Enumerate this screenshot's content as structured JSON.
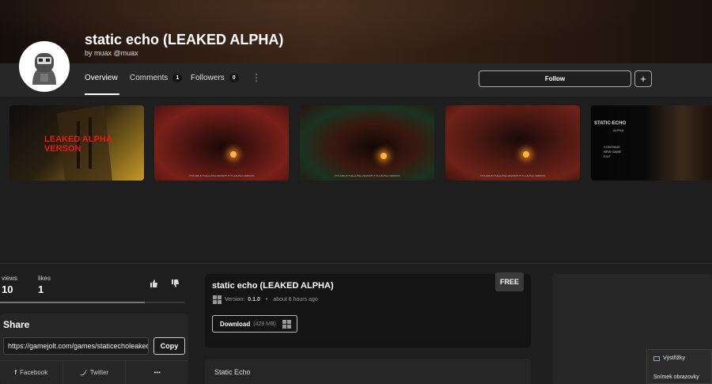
{
  "game": {
    "title": "static echo (LEAKED ALPHA)",
    "author": "by muax @muax"
  },
  "nav": {
    "overview": "Overview",
    "comments": "Comments",
    "comments_count": "1",
    "followers": "Followers",
    "followers_count": "0",
    "more": "⋮",
    "follow": "Follow",
    "plus": "+"
  },
  "thumbnails": {
    "first_overlay": "LEAKED ALPHA VERSON",
    "caption": "YOU ARE IN THE ALPHA VERSION IT IS A ALPHA VERSION",
    "menu_title": "STATIC-ECHO",
    "menu_subtitle": "ALPHA",
    "menu_items": [
      "CONTINUE",
      "NEW GAME",
      "EXIT"
    ]
  },
  "stats": {
    "views_label": "views",
    "views_value": "10",
    "likes_label": "likes",
    "likes_value": "1",
    "like_ratio": 0.78
  },
  "share": {
    "title": "Share",
    "url": "https://gamejolt.com/games/staticecholeaked/",
    "copy": "Copy",
    "facebook": "Facebook",
    "twitter": "Twitter",
    "more": "•••"
  },
  "build": {
    "title": "static echo (LEAKED ALPHA)",
    "price": "FREE",
    "version_label": "Version:",
    "version": "0.1.0",
    "time": "about 6 hours ago",
    "download": "Download",
    "size": "(429 MB)"
  },
  "description": {
    "text": "Static Echo"
  },
  "context_menu": {
    "item1": "Výstřižky",
    "item2": "Snímek obrazovky"
  },
  "colors": {
    "background": "#1e1e1e",
    "panel": "#262626",
    "accent_red": "#e51b1b"
  }
}
